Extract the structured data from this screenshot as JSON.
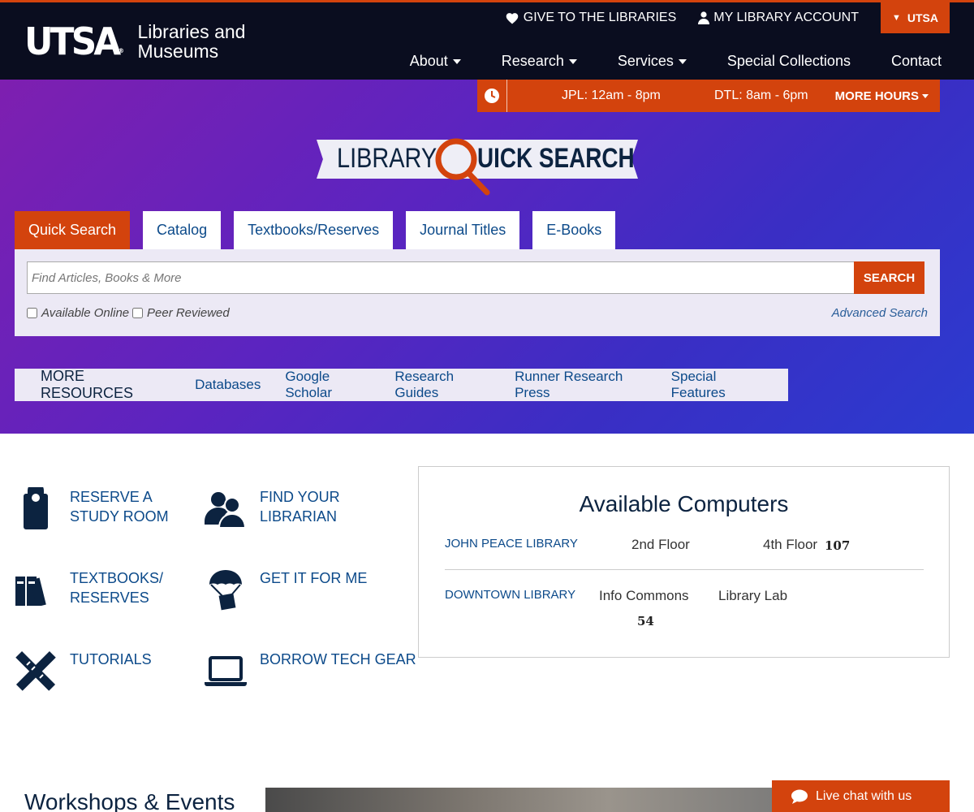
{
  "header": {
    "logo_main": "UTSA",
    "logo_sub_line1": "Libraries and",
    "logo_sub_line2": "Museums",
    "util_give": "GIVE TO THE LIBRARIES",
    "util_account": "MY LIBRARY ACCOUNT",
    "utsa_tab": "UTSA",
    "nav": [
      {
        "label": "About",
        "dropdown": true
      },
      {
        "label": "Research",
        "dropdown": true
      },
      {
        "label": "Services",
        "dropdown": true
      },
      {
        "label": "Special Collections",
        "dropdown": false
      },
      {
        "label": "Contact",
        "dropdown": false
      }
    ]
  },
  "hours": {
    "jpl": "JPL: 12am - 8pm",
    "dtl": "DTL: 8am - 6pm",
    "more": "MORE HOURS"
  },
  "quick_search": {
    "title_left": "LIBRARY",
    "title_right": "UICK SEARCH",
    "tabs": [
      {
        "label": "Quick Search",
        "active": true
      },
      {
        "label": "Catalog",
        "active": false
      },
      {
        "label": "Textbooks/Reserves",
        "active": false
      },
      {
        "label": "Journal Titles",
        "active": false
      },
      {
        "label": "E-Books",
        "active": false
      }
    ],
    "input_placeholder": "Find Articles, Books & More",
    "input_value": "",
    "search_button": "SEARCH",
    "check_online": "Available Online",
    "check_peer": "Peer Reviewed",
    "advanced": "Advanced Search"
  },
  "more_resources": {
    "label": "MORE RESOURCES",
    "links": [
      "Databases",
      "Google Scholar",
      "Research Guides",
      "Runner Research Press",
      "Special Features"
    ]
  },
  "quick_links": {
    "reserve": "RESERVE A\nSTUDY ROOM",
    "librarian": "FIND YOUR\nLIBRARIAN",
    "textbooks": "TEXTBOOKS/\nRESERVES",
    "getit": "GET IT FOR ME",
    "tutorials": "TUTORIALS",
    "tech": "BORROW TECH GEAR"
  },
  "available_computers": {
    "title": "Available Computers",
    "jpl_name": "JOHN PEACE LIBRARY",
    "jpl_floor2": "2nd Floor",
    "jpl_floor4": "4th Floor",
    "jpl_floor4_count": "107",
    "dtl_name": "DOWNTOWN LIBRARY",
    "dtl_info": "Info Commons",
    "dtl_info_count": "54",
    "dtl_lab": "Library Lab"
  },
  "bottom": {
    "workshops_heading": "Workshops & Events",
    "live_chat": "Live chat with us"
  },
  "colors": {
    "accent": "#d3430d",
    "navy": "#0c2340",
    "link": "#0c4a8a"
  }
}
